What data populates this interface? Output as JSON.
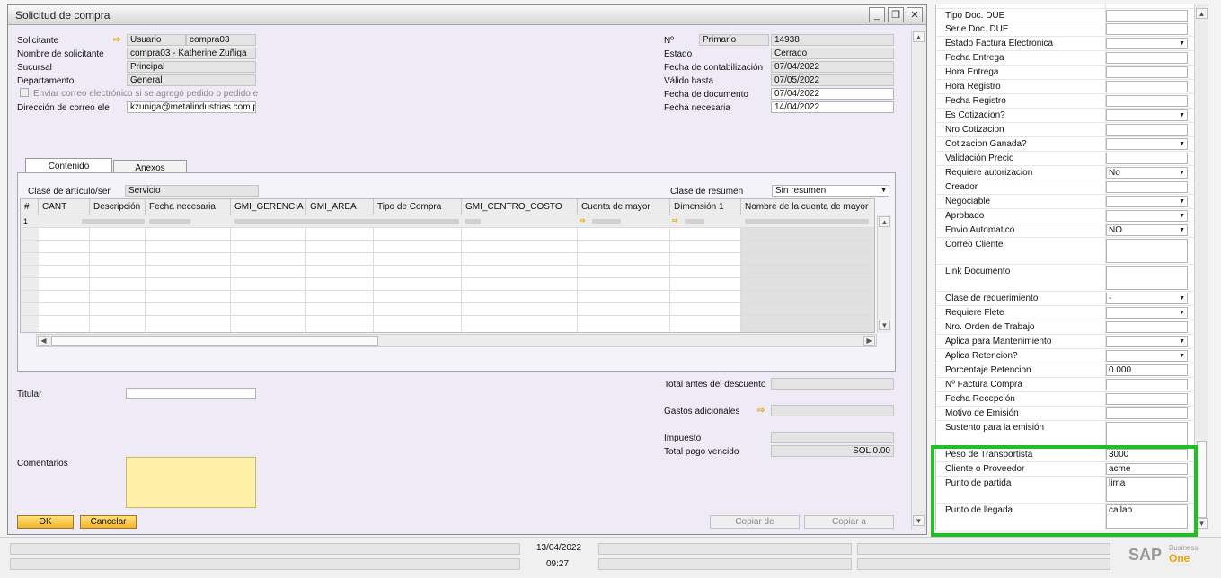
{
  "window": {
    "title": "Solicitud de compra"
  },
  "header_left": {
    "solicitante_label": "Solicitante",
    "solicitante_type": "Usuario",
    "solicitante_value": "compra03",
    "nombre_label": "Nombre de solicitante",
    "nombre_value": "compra03 - Katherine Zuñiga",
    "sucursal_label": "Sucursal",
    "sucursal_value": "Principal",
    "departamento_label": "Departamento",
    "departamento_value": "General",
    "enviar_label": "Enviar correo electrónico si se agregó pedido o pedido e",
    "correo_label": "Dirección de correo ele",
    "correo_value": "kzuniga@metalindustrias.com.pe"
  },
  "header_right": {
    "no_label": "Nº",
    "serie_value": "Primario",
    "no_value": "14938",
    "estado_label": "Estado",
    "estado_value": "Cerrado",
    "fcont_label": "Fecha de contabilización",
    "fcont_value": "07/04/2022",
    "valido_label": "Válido hasta",
    "valido_value": "07/05/2022",
    "fdoc_label": "Fecha de documento",
    "fdoc_value": "07/04/2022",
    "fnec_label": "Fecha necesaria",
    "fnec_value": "14/04/2022"
  },
  "tabs": {
    "contenido": "Contenido",
    "anexos": "Anexos"
  },
  "content": {
    "clase_label": "Clase de artículo/ser",
    "clase_value": "Servicio",
    "resumen_label": "Clase de resumen",
    "resumen_value": "Sin resumen",
    "columns": [
      "#",
      "CANT",
      "Descripción",
      "Fecha necesaria",
      "GMI_GERENCIA",
      "GMI_AREA",
      "Tipo de Compra",
      "GMI_CENTRO_COSTO",
      "Cuenta de mayor",
      "Dimensión 1",
      "Nombre de la cuenta de mayor"
    ],
    "row1_num": "1"
  },
  "footer": {
    "titular_label": "Titular",
    "comentarios_label": "Comentarios",
    "total_antes_label": "Total antes del descuento",
    "gastos_label": "Gastos adicionales",
    "impuesto_label": "Impuesto",
    "total_pago_label": "Total pago vencido",
    "total_pago_value": "SOL 0.00",
    "ok_label": "OK",
    "cancel_label": "Cancelar",
    "copiar_de_label": "Copiar de",
    "copiar_a_label": "Copiar a"
  },
  "udf": [
    {
      "label": "Tipo Doc. DUE",
      "value": ""
    },
    {
      "label": "Serie Doc. DUE",
      "value": ""
    },
    {
      "label": "Estado Factura Electronica",
      "value": ""
    },
    {
      "label": "Fecha Entrega",
      "value": ""
    },
    {
      "label": "Hora Entrega",
      "value": ""
    },
    {
      "label": "Hora Registro",
      "value": ""
    },
    {
      "label": "Fecha Registro",
      "value": ""
    },
    {
      "label": "Es Cotizacion?",
      "value": ""
    },
    {
      "label": "Nro Cotizacion",
      "value": ""
    },
    {
      "label": "Cotizacion Ganada?",
      "value": ""
    },
    {
      "label": "Validación Precio",
      "value": ""
    },
    {
      "label": "Requiere autorizacion",
      "value": "No"
    },
    {
      "label": "Creador",
      "value": ""
    },
    {
      "label": "Negociable",
      "value": ""
    },
    {
      "label": "Aprobado",
      "value": ""
    },
    {
      "label": "Envio Automatico",
      "value": "NO"
    },
    {
      "label": "Correo Cliente",
      "value": ""
    },
    {
      "label": "Link Documento",
      "value": ""
    },
    {
      "label": "Clase de requerimiento",
      "value": "-"
    },
    {
      "label": "Requiere Flete",
      "value": ""
    },
    {
      "label": "Nro. Orden de Trabajo",
      "value": ""
    },
    {
      "label": "Aplica para Mantenimiento",
      "value": ""
    },
    {
      "label": "Aplica Retencion?",
      "value": ""
    },
    {
      "label": "Porcentaje Retencion",
      "value": "0.000"
    },
    {
      "label": "Nº Factura Compra",
      "value": ""
    },
    {
      "label": "Fecha Recepción",
      "value": ""
    },
    {
      "label": "Motivo de Emisión",
      "value": ""
    },
    {
      "label": "Sustento para la emisión",
      "value": ""
    },
    {
      "label": "Peso de Transportista",
      "value": "3000"
    },
    {
      "label": "Cliente o Proveedor",
      "value": "acme"
    },
    {
      "label": "Punto de partida",
      "value": "lima"
    },
    {
      "label": "Punto de llegada",
      "value": "callao"
    }
  ],
  "statusbar": {
    "date": "13/04/2022",
    "time": "09:27",
    "brand_sap": "SAP",
    "brand_business": "Business",
    "brand_one": "One"
  },
  "colors": {
    "highlight": "#1fbf26",
    "ok_button": "#f3b52d",
    "comentarios_bg": "#fff0a8"
  }
}
